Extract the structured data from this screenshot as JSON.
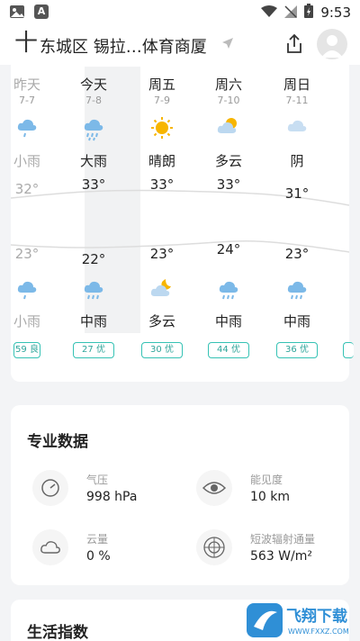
{
  "status_bar": {
    "time": "9:53",
    "app_icon_letter": "A"
  },
  "header": {
    "add_symbol": "十",
    "location": "东城区 锡拉…体育商厦"
  },
  "forecast": {
    "days": [
      {
        "name": "昨天",
        "date": "7-7",
        "day_icon": "light-rain-icon",
        "day_cond": "小雨",
        "high": "32°",
        "low": "23°",
        "night_icon": "light-rain-icon",
        "night_cond": "小雨",
        "aqi": "59 良",
        "past": true
      },
      {
        "name": "今天",
        "date": "7-8",
        "day_icon": "heavy-rain-icon",
        "day_cond": "大雨",
        "high": "33°",
        "low": "22°",
        "night_icon": "moderate-rain-icon",
        "night_cond": "中雨",
        "aqi": "27 优",
        "past": false
      },
      {
        "name": "周五",
        "date": "7-9",
        "day_icon": "sun-icon",
        "day_cond": "晴朗",
        "high": "33°",
        "low": "23°",
        "night_icon": "partly-cloudy-night-icon",
        "night_cond": "多云",
        "aqi": "30 优",
        "past": false
      },
      {
        "name": "周六",
        "date": "7-10",
        "day_icon": "partly-cloudy-icon",
        "day_cond": "多云",
        "high": "33°",
        "low": "24°",
        "night_icon": "moderate-rain-icon",
        "night_cond": "中雨",
        "aqi": "44 优",
        "past": false
      },
      {
        "name": "周日",
        "date": "7-11",
        "day_icon": "cloud-icon",
        "day_cond": "阴",
        "high": "31°",
        "low": "23°",
        "night_icon": "moderate-rain-icon",
        "night_cond": "中雨",
        "aqi": "36 优",
        "past": false
      }
    ]
  },
  "pro_data": {
    "title": "专业数据",
    "pressure": {
      "label": "气压",
      "value": "998 hPa"
    },
    "visibility": {
      "label": "能见度",
      "value": "10 km"
    },
    "cloud": {
      "label": "云量",
      "value": "0 %"
    },
    "radiation": {
      "label": "短波辐射通量",
      "value": "563 W/m²"
    }
  },
  "life_index": {
    "title": "生活指数"
  },
  "watermark": {
    "text": "飞翔下载",
    "url": "WWW.FXXZ.COM"
  },
  "colors": {
    "rain_blue": "#7cb9e8",
    "sun_yellow": "#f7b500",
    "aqi_teal": "#35c2b4"
  }
}
